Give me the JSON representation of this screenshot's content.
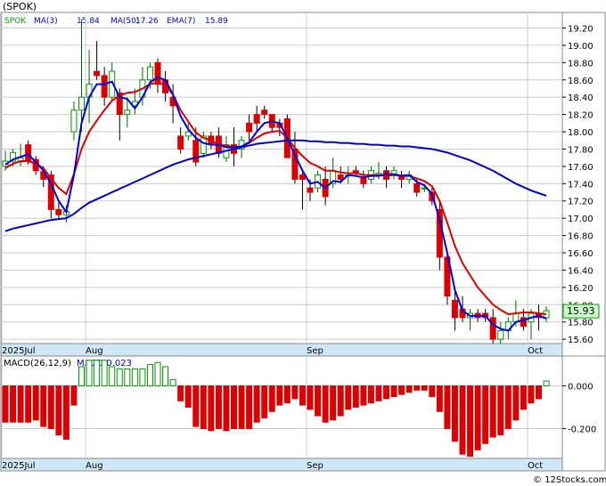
{
  "header": {
    "symbol_label": "(SPOK)",
    "legend": [
      {
        "text": "SPOK",
        "color": "#009900"
      },
      {
        "text": "MA(3)",
        "color": "#0000cc"
      },
      {
        "text": "15.84",
        "color": "#0000cc"
      },
      {
        "text": "MA(50)",
        "color": "#0000cc"
      },
      {
        "text": "17.26",
        "color": "#0000cc"
      },
      {
        "text": "EMA(7)",
        "color": "#0000cc"
      },
      {
        "text": "15.89",
        "color": "#0000cc"
      }
    ]
  },
  "macd_panel": {
    "label_name": "MACD(26,12,9)",
    "label_value": "MACD:0.023"
  },
  "last_price_tag": "15.93",
  "watermark": "© 12Stocks.com",
  "colors": {
    "up": "#009900",
    "down": "#dd0000",
    "ma3": "#0000dd",
    "ma50": "#0000cc",
    "ema7": "#dd0000",
    "axis_strip": "#cfe8f8",
    "grid": "#cccccc"
  },
  "chart_data": [
    {
      "type": "candlestick",
      "y_ticks": [
        "19.20",
        "19.00",
        "18.80",
        "18.60",
        "18.40",
        "18.20",
        "18.00",
        "17.80",
        "17.60",
        "17.40",
        "17.20",
        "17.00",
        "16.80",
        "16.60",
        "16.40",
        "16.20",
        "16.00",
        "15.80",
        "15.60"
      ],
      "ylim": [
        15.55,
        19.38
      ],
      "x_ticks": [
        {
          "label": "2025Jul",
          "index": 0
        },
        {
          "label": "Aug",
          "index": 11
        },
        {
          "label": "Sep",
          "index": 40
        },
        {
          "label": "Oct",
          "index": 69
        }
      ],
      "candles": [
        [
          17.6,
          17.78,
          17.55,
          17.66
        ],
        [
          17.66,
          17.8,
          17.6,
          17.76
        ],
        [
          17.65,
          17.86,
          17.6,
          17.7
        ],
        [
          17.85,
          17.9,
          17.62,
          17.66
        ],
        [
          17.68,
          17.72,
          17.5,
          17.55
        ],
        [
          17.54,
          17.6,
          17.36,
          17.45
        ],
        [
          17.5,
          17.55,
          17.0,
          17.1
        ],
        [
          17.1,
          17.2,
          17.0,
          17.04
        ],
        [
          17.04,
          17.15,
          16.95,
          17.08
        ],
        [
          18.0,
          18.35,
          17.9,
          18.25
        ],
        [
          18.25,
          19.3,
          18.0,
          18.4
        ],
        [
          18.4,
          18.95,
          18.1,
          18.55
        ],
        [
          18.7,
          19.05,
          18.6,
          18.65
        ],
        [
          18.65,
          18.75,
          18.3,
          18.4
        ],
        [
          18.4,
          18.8,
          18.35,
          18.7
        ],
        [
          18.45,
          18.5,
          17.9,
          18.2
        ],
        [
          18.2,
          18.4,
          18.05,
          18.25
        ],
        [
          18.3,
          18.5,
          18.2,
          18.35
        ],
        [
          18.4,
          18.75,
          18.3,
          18.6
        ],
        [
          18.6,
          18.8,
          18.5,
          18.75
        ],
        [
          18.8,
          18.85,
          18.45,
          18.55
        ],
        [
          18.6,
          18.7,
          18.35,
          18.45
        ],
        [
          18.4,
          18.55,
          18.1,
          18.3
        ],
        [
          17.95,
          18.05,
          17.75,
          17.8
        ],
        [
          17.95,
          18.1,
          17.9,
          18.0
        ],
        [
          17.9,
          18.05,
          17.6,
          17.65
        ],
        [
          17.75,
          18.0,
          17.7,
          17.95
        ],
        [
          17.95,
          18.0,
          17.8,
          17.85
        ],
        [
          17.95,
          18.05,
          17.7,
          17.75
        ],
        [
          17.7,
          17.95,
          17.65,
          17.85
        ],
        [
          17.85,
          18.05,
          17.6,
          17.75
        ],
        [
          17.8,
          17.95,
          17.7,
          17.9
        ],
        [
          18.1,
          18.2,
          17.9,
          18.0
        ],
        [
          18.2,
          18.3,
          18.0,
          18.1
        ],
        [
          18.25,
          18.3,
          18.15,
          18.2
        ],
        [
          18.2,
          18.15,
          18.0,
          18.05
        ],
        [
          18.1,
          18.15,
          17.95,
          18.05
        ],
        [
          18.15,
          18.2,
          17.9,
          17.7
        ],
        [
          17.8,
          18.0,
          17.4,
          17.45
        ],
        [
          17.5,
          17.55,
          17.1,
          17.45
        ],
        [
          17.35,
          17.45,
          17.2,
          17.3
        ],
        [
          17.35,
          17.55,
          17.3,
          17.5
        ],
        [
          17.45,
          17.6,
          17.15,
          17.25
        ],
        [
          17.4,
          17.7,
          17.35,
          17.55
        ],
        [
          17.5,
          17.6,
          17.4,
          17.45
        ],
        [
          17.5,
          17.6,
          17.4,
          17.5
        ],
        [
          17.55,
          17.6,
          17.5,
          17.52
        ],
        [
          17.48,
          17.55,
          17.35,
          17.4
        ],
        [
          17.45,
          17.6,
          17.4,
          17.55
        ],
        [
          17.5,
          17.65,
          17.45,
          17.52
        ],
        [
          17.55,
          17.6,
          17.35,
          17.45
        ],
        [
          17.5,
          17.6,
          17.45,
          17.55
        ],
        [
          17.5,
          17.55,
          17.35,
          17.45
        ],
        [
          17.45,
          17.55,
          17.4,
          17.5
        ],
        [
          17.4,
          17.45,
          17.25,
          17.3
        ],
        [
          17.35,
          17.4,
          17.3,
          17.35
        ],
        [
          17.3,
          17.35,
          17.15,
          17.2
        ],
        [
          17.1,
          17.2,
          16.4,
          16.55
        ],
        [
          16.55,
          16.6,
          16.0,
          16.1
        ],
        [
          16.05,
          16.15,
          15.7,
          15.85
        ],
        [
          15.95,
          16.1,
          15.8,
          15.85
        ],
        [
          15.85,
          15.95,
          15.7,
          15.9
        ],
        [
          15.9,
          15.95,
          15.8,
          15.85
        ],
        [
          15.9,
          15.95,
          15.8,
          15.85
        ],
        [
          15.85,
          15.95,
          15.55,
          15.6
        ],
        [
          15.6,
          15.8,
          15.55,
          15.7
        ],
        [
          15.7,
          15.85,
          15.6,
          15.8
        ],
        [
          15.8,
          16.05,
          15.75,
          15.9
        ],
        [
          15.85,
          15.95,
          15.7,
          15.75
        ],
        [
          15.8,
          15.95,
          15.6,
          15.9
        ],
        [
          15.9,
          16.0,
          15.7,
          15.85
        ],
        [
          15.85,
          15.98,
          15.8,
          15.93
        ]
      ],
      "ma3": [
        17.62,
        17.68,
        17.71,
        17.74,
        17.65,
        17.55,
        17.4,
        17.2,
        17.07,
        17.5,
        18.1,
        18.4,
        18.55,
        18.55,
        18.58,
        18.4,
        18.38,
        18.27,
        18.4,
        18.57,
        18.63,
        18.6,
        18.43,
        18.18,
        18.03,
        17.93,
        17.87,
        17.85,
        17.85,
        17.82,
        17.82,
        17.83,
        17.88,
        18.0,
        18.1,
        18.12,
        18.1,
        17.93,
        17.73,
        17.55,
        17.4,
        17.42,
        17.35,
        17.43,
        17.42,
        17.5,
        17.49,
        17.47,
        17.49,
        17.49,
        17.51,
        17.51,
        17.49,
        17.5,
        17.42,
        17.38,
        17.28,
        16.98,
        16.6,
        16.17,
        15.93,
        15.87,
        15.87,
        15.87,
        15.77,
        15.72,
        15.7,
        15.8,
        15.82,
        15.85,
        15.87,
        15.84
      ],
      "ma50": [
        16.85,
        16.88,
        16.9,
        16.92,
        16.94,
        16.96,
        16.98,
        16.99,
        17.0,
        17.05,
        17.12,
        17.18,
        17.22,
        17.26,
        17.3,
        17.34,
        17.38,
        17.42,
        17.46,
        17.5,
        17.54,
        17.58,
        17.62,
        17.65,
        17.68,
        17.7,
        17.72,
        17.74,
        17.76,
        17.78,
        17.8,
        17.82,
        17.84,
        17.86,
        17.87,
        17.88,
        17.89,
        17.9,
        17.9,
        17.9,
        17.89,
        17.89,
        17.88,
        17.88,
        17.87,
        17.87,
        17.86,
        17.86,
        17.85,
        17.85,
        17.84,
        17.84,
        17.83,
        17.83,
        17.82,
        17.81,
        17.8,
        17.78,
        17.76,
        17.73,
        17.7,
        17.67,
        17.63,
        17.59,
        17.55,
        17.5,
        17.45,
        17.4,
        17.36,
        17.32,
        17.29,
        17.26
      ],
      "ema7": [
        17.58,
        17.63,
        17.66,
        17.66,
        17.63,
        17.58,
        17.46,
        17.35,
        17.28,
        17.51,
        17.8,
        18.0,
        18.13,
        18.25,
        18.36,
        18.42,
        18.45,
        18.46,
        18.5,
        18.55,
        18.57,
        18.54,
        18.43,
        18.25,
        18.12,
        17.99,
        17.93,
        17.9,
        17.85,
        17.84,
        17.82,
        17.83,
        17.87,
        17.93,
        17.98,
        18.0,
        18.01,
        17.93,
        17.81,
        17.72,
        17.64,
        17.6,
        17.55,
        17.55,
        17.53,
        17.52,
        17.52,
        17.5,
        17.5,
        17.5,
        17.49,
        17.5,
        17.49,
        17.49,
        17.46,
        17.43,
        17.37,
        17.2,
        16.95,
        16.68,
        16.48,
        16.34,
        16.2,
        16.1,
        16.0,
        15.94,
        15.89,
        15.9,
        15.91,
        15.91,
        15.9,
        15.89
      ]
    },
    {
      "type": "bar",
      "y_ticks": [
        "0.000",
        "-0.200"
      ],
      "ylim": [
        -0.34,
        0.14
      ],
      "values": [
        -0.17,
        -0.17,
        -0.17,
        -0.17,
        -0.16,
        -0.19,
        -0.2,
        -0.23,
        -0.25,
        -0.09,
        0.09,
        0.12,
        0.12,
        0.12,
        0.09,
        0.08,
        0.08,
        0.08,
        0.08,
        0.1,
        0.11,
        0.09,
        0.03,
        -0.07,
        -0.1,
        -0.19,
        -0.2,
        -0.21,
        -0.2,
        -0.21,
        -0.2,
        -0.2,
        -0.2,
        -0.17,
        -0.15,
        -0.12,
        -0.09,
        -0.08,
        -0.06,
        -0.09,
        -0.11,
        -0.14,
        -0.17,
        -0.16,
        -0.14,
        -0.11,
        -0.1,
        -0.09,
        -0.08,
        -0.07,
        -0.06,
        -0.05,
        -0.04,
        -0.03,
        -0.02,
        -0.02,
        -0.05,
        -0.12,
        -0.2,
        -0.26,
        -0.32,
        -0.33,
        -0.3,
        -0.27,
        -0.24,
        -0.23,
        -0.2,
        -0.16,
        -0.11,
        -0.08,
        -0.06,
        0.023
      ]
    }
  ]
}
